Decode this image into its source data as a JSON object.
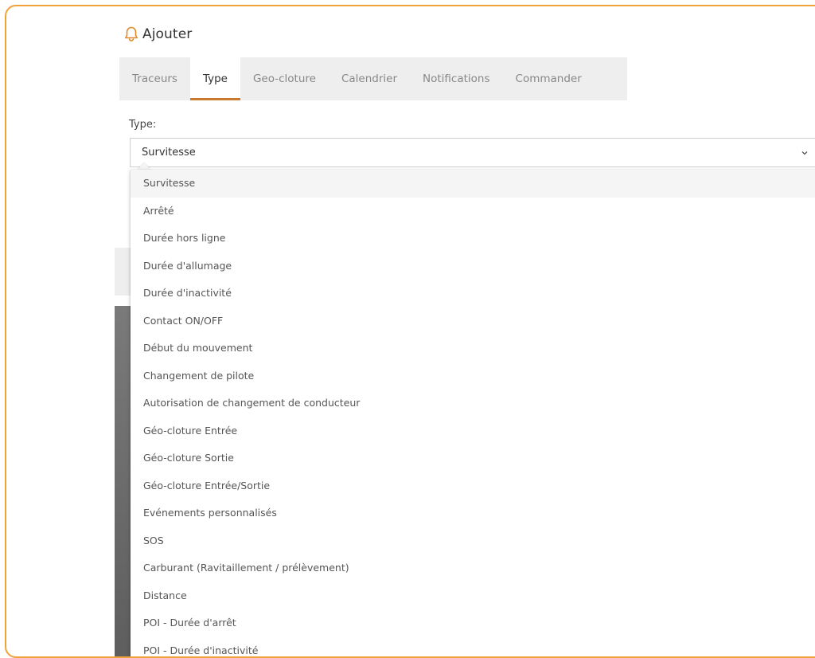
{
  "header": {
    "title": "Ajouter",
    "icon": "bell-icon",
    "icon_color": "#e08a2c"
  },
  "tabs": [
    {
      "label": "Traceurs",
      "active": false
    },
    {
      "label": "Type",
      "active": true
    },
    {
      "label": "Geo-cloture",
      "active": false
    },
    {
      "label": "Calendrier",
      "active": false
    },
    {
      "label": "Notifications",
      "active": false
    },
    {
      "label": "Commander",
      "active": false
    }
  ],
  "form": {
    "type_label": "Type:",
    "selected_value": "Survitesse"
  },
  "options": [
    "Survitesse",
    "Arrêté",
    "Durée hors ligne",
    "Durée d'allumage",
    "Durée d'inactivité",
    "Contact ON/OFF",
    "Début du mouvement",
    "Changement de pilote",
    "Autorisation de changement de conducteur",
    "Géo-cloture Entrée",
    "Géo-cloture Sortie",
    "Géo-cloture Entrée/Sortie",
    "Evénements personnalisés",
    "SOS",
    "Carburant (Ravitaillement / prélèvement)",
    "Distance",
    "POI - Durée d'arrêt",
    "POI - Durée d'inactivité"
  ],
  "colors": {
    "frame_border": "#f0a23a",
    "tab_active_underline": "#c97a2e",
    "tab_bar": "#eeeeee"
  }
}
